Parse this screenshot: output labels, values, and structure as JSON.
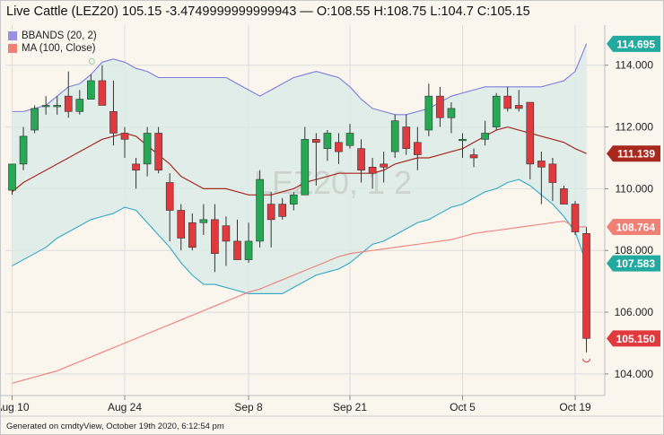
{
  "header": {
    "title": "Live Cattle (LEZ20) 105.15 -3.4749999999999943 — O:108.55 H:108.75 L:104.7 C:105.15"
  },
  "legend": [
    {
      "label": "BBANDS (20, 2)",
      "color": "#9b8fe0"
    },
    {
      "label": "MA (100, Close)",
      "color": "#f07f76"
    }
  ],
  "watermark": "LEZ20, 1 2",
  "footer": {
    "text": "Generated on cmdtyView, October 19th 2020, 6:12:54 pm"
  },
  "colors": {
    "up": "#27a854",
    "down": "#e0393e",
    "band_fill": "#dcebe6",
    "band_upper": "#7d7de0",
    "band_lower": "#2fa8c8",
    "band_mid": "#a8281e",
    "ma": "#f07f76"
  },
  "chart_data": {
    "type": "candlestick",
    "ylim": [
      103.3,
      115.3
    ],
    "y_ticks": [
      104,
      106,
      108,
      110,
      112,
      114
    ],
    "x_labels": [
      {
        "label": "Aug 10",
        "index": 0
      },
      {
        "label": "Aug 24",
        "index": 10
      },
      {
        "label": "Sep 8",
        "index": 21
      },
      {
        "label": "Sep 21",
        "index": 30
      },
      {
        "label": "Oct 5",
        "index": 40
      },
      {
        "label": "Oct 19",
        "index": 50
      }
    ],
    "candles": [
      {
        "o": 109.95,
        "h": 110.3,
        "l": 109.8,
        "c": 110.8
      },
      {
        "o": 110.8,
        "h": 112.0,
        "l": 110.6,
        "c": 111.7
      },
      {
        "o": 111.9,
        "h": 112.7,
        "l": 111.8,
        "c": 112.6
      },
      {
        "o": 112.7,
        "h": 113.0,
        "l": 112.4,
        "c": 112.7
      },
      {
        "o": 112.7,
        "h": 113.0,
        "l": 112.4,
        "c": 112.7
      },
      {
        "o": 113.0,
        "h": 113.8,
        "l": 112.3,
        "c": 112.5
      },
      {
        "o": 112.5,
        "h": 113.2,
        "l": 112.4,
        "c": 112.9
      },
      {
        "o": 112.9,
        "h": 113.7,
        "l": 112.9,
        "c": 113.5
      },
      {
        "o": 113.5,
        "h": 114.0,
        "l": 112.8,
        "c": 112.7
      },
      {
        "o": 112.5,
        "h": 113.5,
        "l": 111.4,
        "c": 111.8
      },
      {
        "o": 111.8,
        "h": 112.0,
        "l": 111.0,
        "c": 111.6
      },
      {
        "o": 110.8,
        "h": 111.0,
        "l": 110.0,
        "c": 110.6
      },
      {
        "o": 110.8,
        "h": 112.0,
        "l": 110.4,
        "c": 111.8
      },
      {
        "o": 111.8,
        "h": 112.0,
        "l": 110.5,
        "c": 110.6
      },
      {
        "o": 110.2,
        "h": 110.5,
        "l": 108.3,
        "c": 109.3
      },
      {
        "o": 109.3,
        "h": 109.5,
        "l": 108.0,
        "c": 108.4
      },
      {
        "o": 108.9,
        "h": 109.2,
        "l": 108.0,
        "c": 108.1
      },
      {
        "o": 108.9,
        "h": 109.5,
        "l": 108.5,
        "c": 109.0
      },
      {
        "o": 109.0,
        "h": 109.5,
        "l": 107.3,
        "c": 107.9
      },
      {
        "o": 108.8,
        "h": 109.1,
        "l": 107.5,
        "c": 108.3
      },
      {
        "o": 108.3,
        "h": 109.0,
        "l": 107.9,
        "c": 107.7
      },
      {
        "o": 107.7,
        "h": 108.9,
        "l": 107.6,
        "c": 108.3
      },
      {
        "o": 108.3,
        "h": 110.6,
        "l": 108.1,
        "c": 110.3
      },
      {
        "o": 109.5,
        "h": 109.9,
        "l": 108.1,
        "c": 109.0
      },
      {
        "o": 109.5,
        "h": 109.7,
        "l": 109.0,
        "c": 109.1
      },
      {
        "o": 109.5,
        "h": 109.9,
        "l": 109.3,
        "c": 109.8
      },
      {
        "o": 109.8,
        "h": 112.0,
        "l": 109.8,
        "c": 111.6
      },
      {
        "o": 111.6,
        "h": 111.8,
        "l": 110.1,
        "c": 111.5
      },
      {
        "o": 111.3,
        "h": 111.9,
        "l": 110.9,
        "c": 111.8
      },
      {
        "o": 111.5,
        "h": 111.8,
        "l": 110.8,
        "c": 111.2
      },
      {
        "o": 111.4,
        "h": 112.1,
        "l": 111.3,
        "c": 111.8
      },
      {
        "o": 111.3,
        "h": 111.6,
        "l": 110.2,
        "c": 110.6
      },
      {
        "o": 110.7,
        "h": 111.0,
        "l": 110.0,
        "c": 110.5
      },
      {
        "o": 110.8,
        "h": 111.2,
        "l": 110.2,
        "c": 110.7
      },
      {
        "o": 111.2,
        "h": 112.4,
        "l": 111.0,
        "c": 112.2
      },
      {
        "o": 112.0,
        "h": 112.4,
        "l": 111.1,
        "c": 111.3
      },
      {
        "o": 111.5,
        "h": 112.0,
        "l": 110.6,
        "c": 111.1
      },
      {
        "o": 111.9,
        "h": 113.4,
        "l": 111.7,
        "c": 113.0
      },
      {
        "o": 113.0,
        "h": 113.3,
        "l": 112.0,
        "c": 112.3
      },
      {
        "o": 112.3,
        "h": 112.8,
        "l": 111.8,
        "c": 112.6
      },
      {
        "o": 111.6,
        "h": 111.8,
        "l": 111.0,
        "c": 111.6
      },
      {
        "o": 111.1,
        "h": 111.3,
        "l": 110.7,
        "c": 111.0
      },
      {
        "o": 111.6,
        "h": 112.2,
        "l": 111.4,
        "c": 111.8
      },
      {
        "o": 112.0,
        "h": 113.1,
        "l": 111.9,
        "c": 113.0
      },
      {
        "o": 113.0,
        "h": 113.3,
        "l": 112.5,
        "c": 112.6
      },
      {
        "o": 112.7,
        "h": 113.2,
        "l": 112.5,
        "c": 112.6
      },
      {
        "o": 112.8,
        "h": 112.8,
        "l": 110.3,
        "c": 110.8
      },
      {
        "o": 110.9,
        "h": 111.2,
        "l": 109.5,
        "c": 110.7
      },
      {
        "o": 110.8,
        "h": 111.0,
        "l": 109.6,
        "c": 110.2
      },
      {
        "o": 110.0,
        "h": 110.1,
        "l": 109.5,
        "c": 109.5
      },
      {
        "o": 109.5,
        "h": 109.6,
        "l": 108.5,
        "c": 108.6
      },
      {
        "o": 108.55,
        "h": 108.75,
        "l": 104.7,
        "c": 105.15
      }
    ],
    "bb_upper": [
      112.5,
      112.5,
      112.6,
      112.7,
      113.0,
      113.3,
      113.4,
      113.7,
      114.1,
      114.2,
      114.1,
      113.9,
      113.8,
      113.6,
      113.6,
      113.6,
      113.6,
      113.6,
      113.6,
      113.6,
      113.4,
      113.2,
      113.0,
      113.2,
      113.4,
      113.6,
      113.7,
      113.8,
      113.7,
      113.6,
      113.3,
      112.9,
      112.6,
      112.5,
      112.4,
      112.4,
      112.5,
      112.6,
      112.8,
      113.0,
      113.1,
      113.2,
      113.3,
      113.3,
      113.3,
      113.3,
      113.3,
      113.3,
      113.4,
      113.5,
      113.8,
      114.695
    ],
    "bb_mid": [
      109.9,
      110.2,
      110.4,
      110.6,
      110.8,
      111.0,
      111.2,
      111.4,
      111.6,
      111.7,
      111.8,
      111.7,
      111.4,
      111.1,
      110.8,
      110.4,
      110.2,
      110.0,
      110.0,
      110.0,
      109.9,
      109.8,
      109.8,
      109.8,
      109.9,
      110.0,
      110.2,
      110.3,
      110.4,
      110.5,
      110.5,
      110.5,
      110.5,
      110.6,
      110.8,
      110.9,
      111.0,
      111.0,
      111.1,
      111.2,
      111.3,
      111.5,
      111.7,
      111.9,
      112.0,
      111.9,
      111.8,
      111.7,
      111.6,
      111.5,
      111.3,
      111.139
    ],
    "bb_lower": [
      107.5,
      107.7,
      107.9,
      108.1,
      108.4,
      108.6,
      108.8,
      109.0,
      109.1,
      109.2,
      109.4,
      109.3,
      108.9,
      108.5,
      108.1,
      107.6,
      107.2,
      106.9,
      106.9,
      106.8,
      106.7,
      106.6,
      106.6,
      106.6,
      106.6,
      106.8,
      107.0,
      107.2,
      107.3,
      107.4,
      107.6,
      107.9,
      108.2,
      108.3,
      108.5,
      108.7,
      108.9,
      109.0,
      109.2,
      109.4,
      109.5,
      109.7,
      109.9,
      110.0,
      110.2,
      110.3,
      110.1,
      109.8,
      109.5,
      109.1,
      108.6,
      107.583
    ],
    "ma100": [
      103.7,
      103.8,
      103.9,
      104.0,
      104.1,
      104.25,
      104.4,
      104.55,
      104.7,
      104.85,
      105.0,
      105.15,
      105.3,
      105.45,
      105.6,
      105.75,
      105.9,
      106.05,
      106.2,
      106.35,
      106.5,
      106.65,
      106.75,
      106.9,
      107.05,
      107.2,
      107.35,
      107.5,
      107.65,
      107.8,
      107.9,
      107.95,
      108.0,
      108.05,
      108.1,
      108.15,
      108.2,
      108.25,
      108.3,
      108.35,
      108.45,
      108.55,
      108.6,
      108.65,
      108.7,
      108.75,
      108.8,
      108.85,
      108.9,
      108.95,
      108.764,
      108.764
    ],
    "price_tags": [
      {
        "value": 114.695,
        "label": "114.695",
        "color": "#22a9a0"
      },
      {
        "value": 111.139,
        "label": "111.139",
        "color": "#a8281e"
      },
      {
        "value": 108.764,
        "label": "108.764",
        "color": "#f07f76"
      },
      {
        "value": 107.583,
        "label": "107.583",
        "color": "#22a9a0"
      },
      {
        "value": 105.15,
        "label": "105.150",
        "color": "#e0393e"
      }
    ]
  }
}
